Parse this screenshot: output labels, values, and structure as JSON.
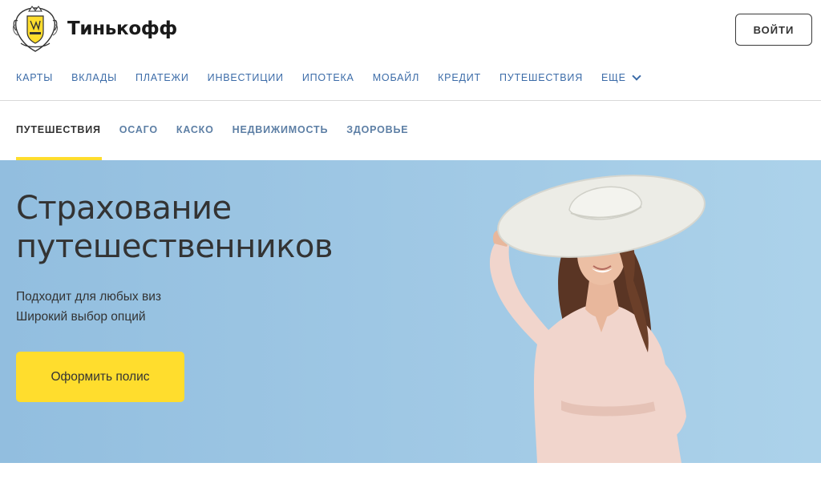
{
  "header": {
    "brand": "Тинькофф",
    "login_label": "ВОЙТИ"
  },
  "main_nav": {
    "items": [
      "КАРТЫ",
      "ВКЛАДЫ",
      "ПЛАТЕЖИ",
      "ИНВЕСТИЦИИ",
      "ИПОТЕКА",
      "МОБАЙЛ",
      "КРЕДИТ",
      "ПУТЕШЕСТВИЯ"
    ],
    "more_label": "ЕЩЕ"
  },
  "sub_nav": {
    "items": [
      "ПУТЕШЕСТВИЯ",
      "ОСАГО",
      "КАСКО",
      "НЕДВИЖИМОСТЬ",
      "ЗДОРОВЬЕ"
    ],
    "active": "ПУТЕШЕСТВИЯ"
  },
  "hero": {
    "title_line1": "Страхование",
    "title_line2": "путешественников",
    "subtitle_line1": "Подходит для любых виз",
    "subtitle_line2": "Широкий выбор опций",
    "cta_label": "Оформить полис"
  },
  "colors": {
    "accent_yellow": "#ffdd2d",
    "nav_blue": "#3c6ca8",
    "hero_bg": "#9ec7e4"
  }
}
